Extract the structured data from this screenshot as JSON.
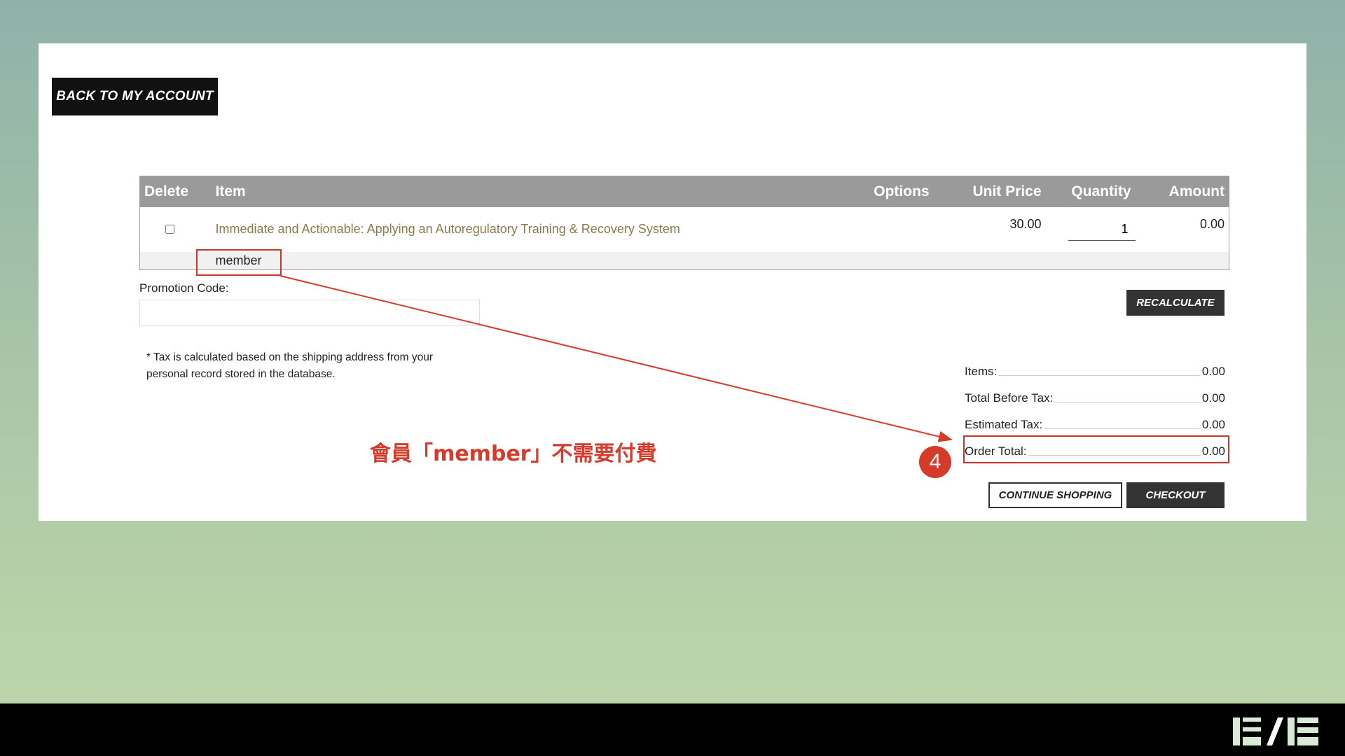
{
  "header": {
    "back_label": "BACK TO MY ACCOUNT"
  },
  "table": {
    "columns": [
      "Delete",
      "Item",
      "Options",
      "Unit Price",
      "Quantity",
      "Amount"
    ],
    "rows": [
      {
        "item": "Immediate and Actionable: Applying an Autoregulatory Training & Recovery System",
        "options": "",
        "unit_price": "30.00",
        "quantity": "1",
        "amount": "0.00",
        "option_label": "member"
      }
    ]
  },
  "promo": {
    "label": "Promotion Code:",
    "value": ""
  },
  "actions": {
    "recalculate": "RECALCULATE",
    "continue": "CONTINUE SHOPPING",
    "checkout": "CHECKOUT"
  },
  "tax_note": "* Tax is calculated based on the shipping address from your personal record stored in the database.",
  "totals": {
    "items_label": "Items:",
    "items_value": "0.00",
    "before_tax_label": "Total Before Tax:",
    "before_tax_value": "0.00",
    "est_tax_label": "Estimated Tax:",
    "est_tax_value": "0.00",
    "order_total_label": "Order Total:",
    "order_total_value": "0.00"
  },
  "annotation": {
    "step": "4",
    "text": "會員「member」不需要付費",
    "color": "#d63a2a"
  }
}
